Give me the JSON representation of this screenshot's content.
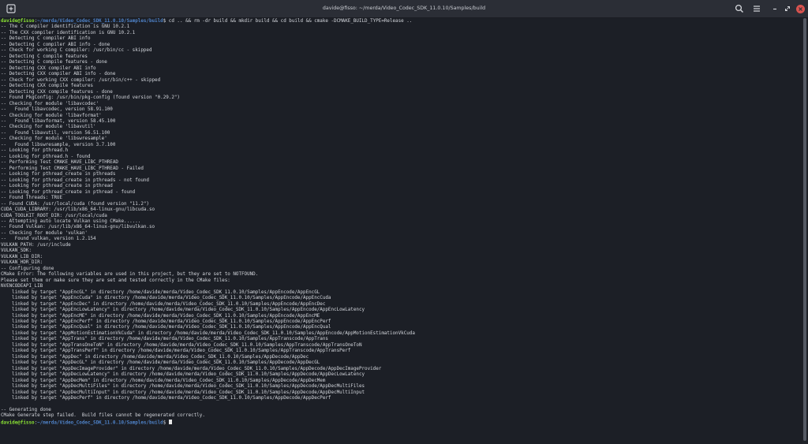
{
  "window": {
    "title": "davide@fisso: ~/merda/Video_Codec_SDK_11.0.10/Samples/build"
  },
  "icons": {
    "new_tab": "new-tab-icon",
    "search": "search-icon",
    "menu": "hamburger-menu-icon",
    "minimize": "minimize-icon",
    "maximize": "maximize-icon",
    "close": "close-icon"
  },
  "colors": {
    "background": "#1c1f26",
    "text": "#d3d6dc",
    "prompt_user": "#8ae234",
    "prompt_path": "#4f83c9",
    "close_button": "#d9534f"
  },
  "terminal": {
    "prompt": {
      "user": "davide@fisso",
      "separator": ":",
      "path": "~/merda/Video_Codec_SDK_11.0.10/Samples/build",
      "symbol": "$"
    },
    "command": " cd .. && rm -dr build && mkdir build && cd build && cmake -DCMAKE_BUILD_TYPE=Release ..",
    "lines": [
      "-- The C compiler identification is GNU 10.2.1",
      "-- The CXX compiler identification is GNU 10.2.1",
      "-- Detecting C compiler ABI info",
      "-- Detecting C compiler ABI info - done",
      "-- Check for working C compiler: /usr/bin/cc - skipped",
      "-- Detecting C compile features",
      "-- Detecting C compile features - done",
      "-- Detecting CXX compiler ABI info",
      "-- Detecting CXX compiler ABI info - done",
      "-- Check for working CXX compiler: /usr/bin/c++ - skipped",
      "-- Detecting CXX compile features",
      "-- Detecting CXX compile features - done",
      "-- Found PkgConfig: /usr/bin/pkg-config (found version \"0.29.2\")",
      "-- Checking for module 'libavcodec'",
      "--   Found libavcodec, version 58.91.100",
      "-- Checking for module 'libavformat'",
      "--   Found libavformat, version 58.45.100",
      "-- Checking for module 'libavutil'",
      "--   Found libavutil, version 56.51.100",
      "-- Checking for module 'libswresample'",
      "--   Found libswresample, version 3.7.100",
      "-- Looking for pthread.h",
      "-- Looking for pthread.h - found",
      "-- Performing Test CMAKE_HAVE_LIBC_PTHREAD",
      "-- Performing Test CMAKE_HAVE_LIBC_PTHREAD - Failed",
      "-- Looking for pthread_create in pthreads",
      "-- Looking for pthread_create in pthreads - not found",
      "-- Looking for pthread_create in pthread",
      "-- Looking for pthread_create in pthread - found",
      "-- Found Threads: TRUE",
      "-- Found CUDA: /usr/local/cuda (found version \"11.2\")",
      "CUDA_CUDA_LIBRARY: /usr/lib/x86_64-linux-gnu/libcuda.so",
      "CUDA_TOOLKIT_ROOT_DIR: /usr/local/cuda",
      "-- Attempting auto locate Vulkan using CMake......",
      "-- Found Vulkan: /usr/lib/x86_64-linux-gnu/libvulkan.so",
      "-- Checking for module 'vulkan'",
      "--   Found vulkan, version 1.2.154",
      "VULKAN_PATH: /usr/include",
      "VULKAN_SDK:",
      "VULKAN_LIB_DIR:",
      "VULKAN_HDR_DIR:",
      "-- Configuring done",
      "CMake Error: The following variables are used in this project, but they are set to NOTFOUND.",
      "Please set them or make sure they are set and tested correctly in the CMake files:",
      "NVENCODEAPI_LIB",
      "    linked by target \"AppEncGL\" in directory /home/davide/merda/Video_Codec_SDK_11.0.10/Samples/AppEncode/AppEncGL",
      "    linked by target \"AppEncCuda\" in directory /home/davide/merda/Video_Codec_SDK_11.0.10/Samples/AppEncode/AppEncCuda",
      "    linked by target \"AppEncDec\" in directory /home/davide/merda/Video_Codec_SDK_11.0.10/Samples/AppEncode/AppEncDec",
      "    linked by target \"AppEncLowLatency\" in directory /home/davide/merda/Video_Codec_SDK_11.0.10/Samples/AppEncode/AppEncLowLatency",
      "    linked by target \"AppEncME\" in directory /home/davide/merda/Video_Codec_SDK_11.0.10/Samples/AppEncode/AppEncME",
      "    linked by target \"AppEncPerf\" in directory /home/davide/merda/Video_Codec_SDK_11.0.10/Samples/AppEncode/AppEncPerf",
      "    linked by target \"AppEncQual\" in directory /home/davide/merda/Video_Codec_SDK_11.0.10/Samples/AppEncode/AppEncQual",
      "    linked by target \"AppMotionEstimationVkCuda\" in directory /home/davide/merda/Video_Codec_SDK_11.0.10/Samples/AppEncode/AppMotionEstimationVkCuda",
      "    linked by target \"AppTrans\" in directory /home/davide/merda/Video_Codec_SDK_11.0.10/Samples/AppTranscode/AppTrans",
      "    linked by target \"AppTransOneToN\" in directory /home/davide/merda/Video_Codec_SDK_11.0.10/Samples/AppTranscode/AppTransOneToN",
      "    linked by target \"AppTransPerf\" in directory /home/davide/merda/Video_Codec_SDK_11.0.10/Samples/AppTranscode/AppTransPerf",
      "    linked by target \"AppDec\" in directory /home/davide/merda/Video_Codec_SDK_11.0.10/Samples/AppDecode/AppDec",
      "    linked by target \"AppDecGL\" in directory /home/davide/merda/Video_Codec_SDK_11.0.10/Samples/AppDecode/AppDecGL",
      "    linked by target \"AppDecImageProvider\" in directory /home/davide/merda/Video_Codec_SDK_11.0.10/Samples/AppDecode/AppDecImageProvider",
      "    linked by target \"AppDecLowLatency\" in directory /home/davide/merda/Video_Codec_SDK_11.0.10/Samples/AppDecode/AppDecLowLatency",
      "    linked by target \"AppDecMem\" in directory /home/davide/merda/Video_Codec_SDK_11.0.10/Samples/AppDecode/AppDecMem",
      "    linked by target \"AppDecMultiFiles\" in directory /home/davide/merda/Video_Codec_SDK_11.0.10/Samples/AppDecode/AppDecMultiFiles",
      "    linked by target \"AppDecMultiInput\" in directory /home/davide/merda/Video_Codec_SDK_11.0.10/Samples/AppDecode/AppDecMultiInput",
      "    linked by target \"AppDecPerf\" in directory /home/davide/merda/Video_Codec_SDK_11.0.10/Samples/AppDecode/AppDecPerf",
      "",
      "-- Generating done",
      "CMake Generate step failed.  Build files cannot be regenerated correctly."
    ]
  }
}
